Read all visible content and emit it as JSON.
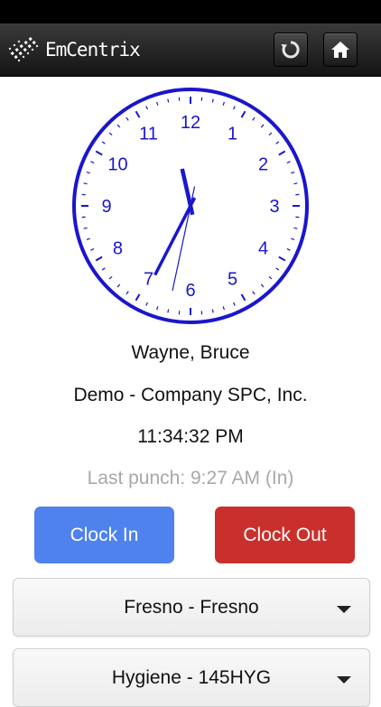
{
  "header": {
    "brand": "EmCentrix",
    "icons": {
      "logo": "emcentrix-logo",
      "refresh": "refresh-icon",
      "home": "home-icon"
    }
  },
  "clock": {
    "numerals": [
      "12",
      "1",
      "2",
      "3",
      "4",
      "5",
      "6",
      "7",
      "8",
      "9",
      "10",
      "11"
    ],
    "time_shown": "11:34:32 PM",
    "color": "#1a16cc"
  },
  "employee": {
    "name": "Wayne, Bruce",
    "company": "Demo - Company SPC, Inc.",
    "current_time": "11:34:32 PM",
    "last_punch": "Last punch:  9:27 AM (In)"
  },
  "actions": {
    "clock_in": "Clock In",
    "clock_out": "Clock Out"
  },
  "selects": {
    "location": "Fresno - Fresno",
    "department": "Hygiene - 145HYG"
  },
  "colors": {
    "clock_in": "#4f82ec",
    "clock_out": "#c9302c",
    "header": "#1e1e1e"
  }
}
